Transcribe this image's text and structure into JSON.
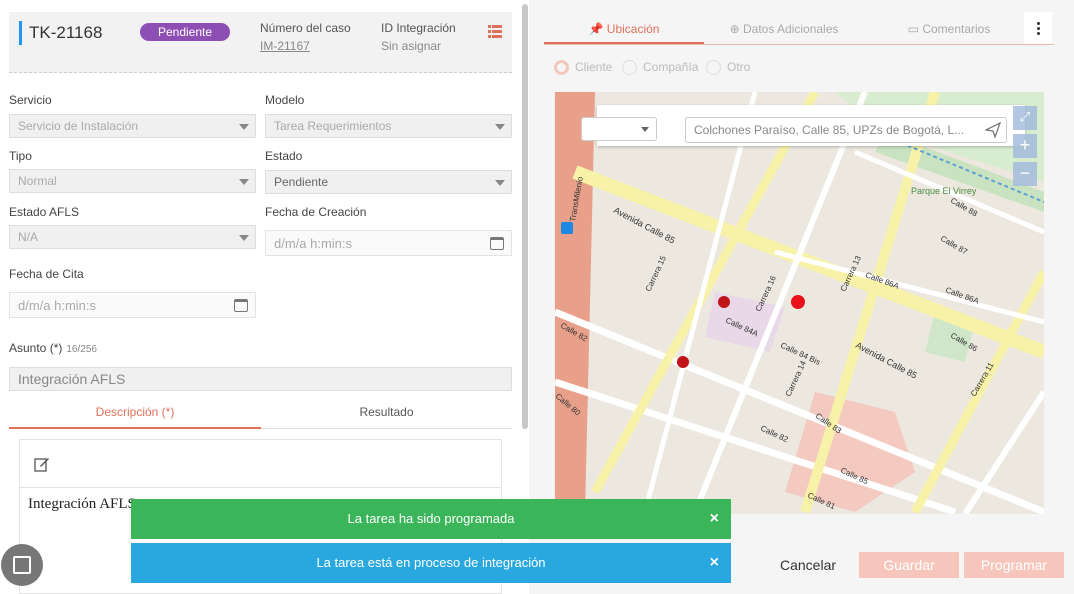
{
  "header": {
    "ticket_id": "TK-21168",
    "status_badge": "Pendiente",
    "case_number_label": "Número del caso",
    "case_number_value": "IM-21167",
    "integration_id_label": "ID Integración",
    "integration_id_value": "Sin asignar",
    "icon": "list-icon"
  },
  "form": {
    "servicio_label": "Servicio",
    "servicio_value": "Servicio de Instalación",
    "modelo_label": "Modelo",
    "modelo_value": "Tarea Requerimientos",
    "tipo_label": "Tipo",
    "tipo_value": "Normal",
    "estado_label": "Estado",
    "estado_value": "Pendiente",
    "estado_afls_label": "Estado AFLS",
    "estado_afls_value": "N/A",
    "fecha_creacion_label": "Fecha de Creación",
    "fecha_creacion_placeholder": "d/m/a h:min:s",
    "fecha_cita_label": "Fecha de Cita",
    "fecha_cita_placeholder": "d/m/a h:min:s",
    "asunto_label": "Asunto (*)",
    "asunto_count": "16/256",
    "asunto_value": "Integración AFLS"
  },
  "left_tabs": {
    "descripcion": "Descripción (*)",
    "resultado": "Resultado"
  },
  "editor": {
    "text": "Integración AFLS"
  },
  "right_tabs": {
    "ubicacion": "Ubicación",
    "datos": "Datos Adicionales",
    "comentarios": "Comentarios"
  },
  "radios": {
    "cliente": "Cliente",
    "compania": "Compañía",
    "otro": "Otro"
  },
  "map": {
    "search_value": "Colchones Paraíso, Calle 85, UPZs de Bogotá, L...",
    "zoom_in": "+",
    "zoom_out": "−",
    "labels": {
      "avenida_calle_85": "Avenida Calle 85",
      "calle_85": "Calle 85",
      "calle_84a": "Calle 84A",
      "calle_84bis": "Calle 84 Bis",
      "calle_86a": "Calle 86A",
      "calle_86a_2": "Calle 86A",
      "calle_86": "Calle 86",
      "calle_87": "Calle 87",
      "calle_88": "Calle 88",
      "calle_82": "Calle 82",
      "calle_82_2": "Calle 82",
      "calle_83": "Calle 83",
      "calle_81": "Calle 81",
      "calle_80": "Calle 80",
      "carrera_15": "Carrera 15",
      "carrera_16": "Carrera 16",
      "carrera_14": "Carrera 14",
      "carrera_13": "Carrera 13",
      "carrera_11": "Carrera 11",
      "parque": "Parque El Virrey",
      "transmilenio": "TransMilenio"
    }
  },
  "buttons": {
    "cancelar": "Cancelar",
    "guardar": "Guardar",
    "programar": "Programar"
  },
  "toasts": {
    "success": "La tarea ha sido programada",
    "info": "La tarea está en proceso de integración",
    "close": "×"
  },
  "colors": {
    "accent": "#e0705a",
    "badge": "#8e4fb4",
    "success": "#3bb55a",
    "info": "#29a8e0"
  }
}
